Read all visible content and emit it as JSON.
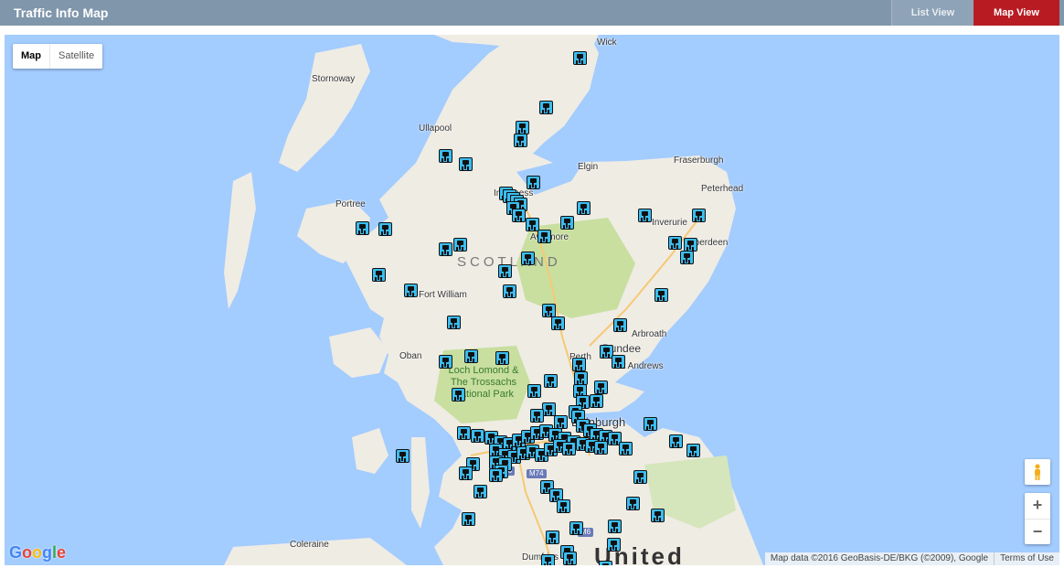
{
  "header": {
    "title": "Traffic Info Map",
    "list_view_label": "List View",
    "map_view_label": "Map View",
    "active_color": "#b81c22",
    "bar_color": "#7f96ab"
  },
  "map": {
    "type_controls": {
      "map_label": "Map",
      "satellite_label": "Satellite",
      "selected": "Map"
    },
    "place_labels": {
      "wick": "Wick",
      "stornoway": "Stornoway",
      "ullapool": "Ullapool",
      "elgin": "Elgin",
      "fraserburgh": "Fraserburgh",
      "peterhead": "Peterhead",
      "portree": "Portree",
      "inverness": "Inverness",
      "inverurie": "Inverurie",
      "aberdeen": "Aberdeen",
      "aviemore": "Aviemore",
      "fort_william": "Fort William",
      "arbroath": "Arbroath",
      "dundee": "Dundee",
      "perth": "Perth",
      "st_andrews": "St Andrews",
      "oban": "Oban",
      "edinburgh": "Edinburgh",
      "coleraine": "Coleraine",
      "dumfries": "Dumfries"
    },
    "region_label": "SCOTLAND",
    "country_label": "United",
    "park_label": "Loch Lomond & The Trossachs National Park",
    "road_labels": {
      "m74": "M74",
      "m8": "M8",
      "m6": "M6"
    },
    "camera_icon": "traffic-camera-icon",
    "camera_color": "#3bbdf0",
    "attribution": "Map data ©2016 GeoBasis-DE/BKG (©2009), Google",
    "terms_label": "Terms of Use",
    "logo": "Google",
    "zoom_in_label": "+",
    "zoom_out_label": "−",
    "pegman_icon": "pegman-icon"
  }
}
